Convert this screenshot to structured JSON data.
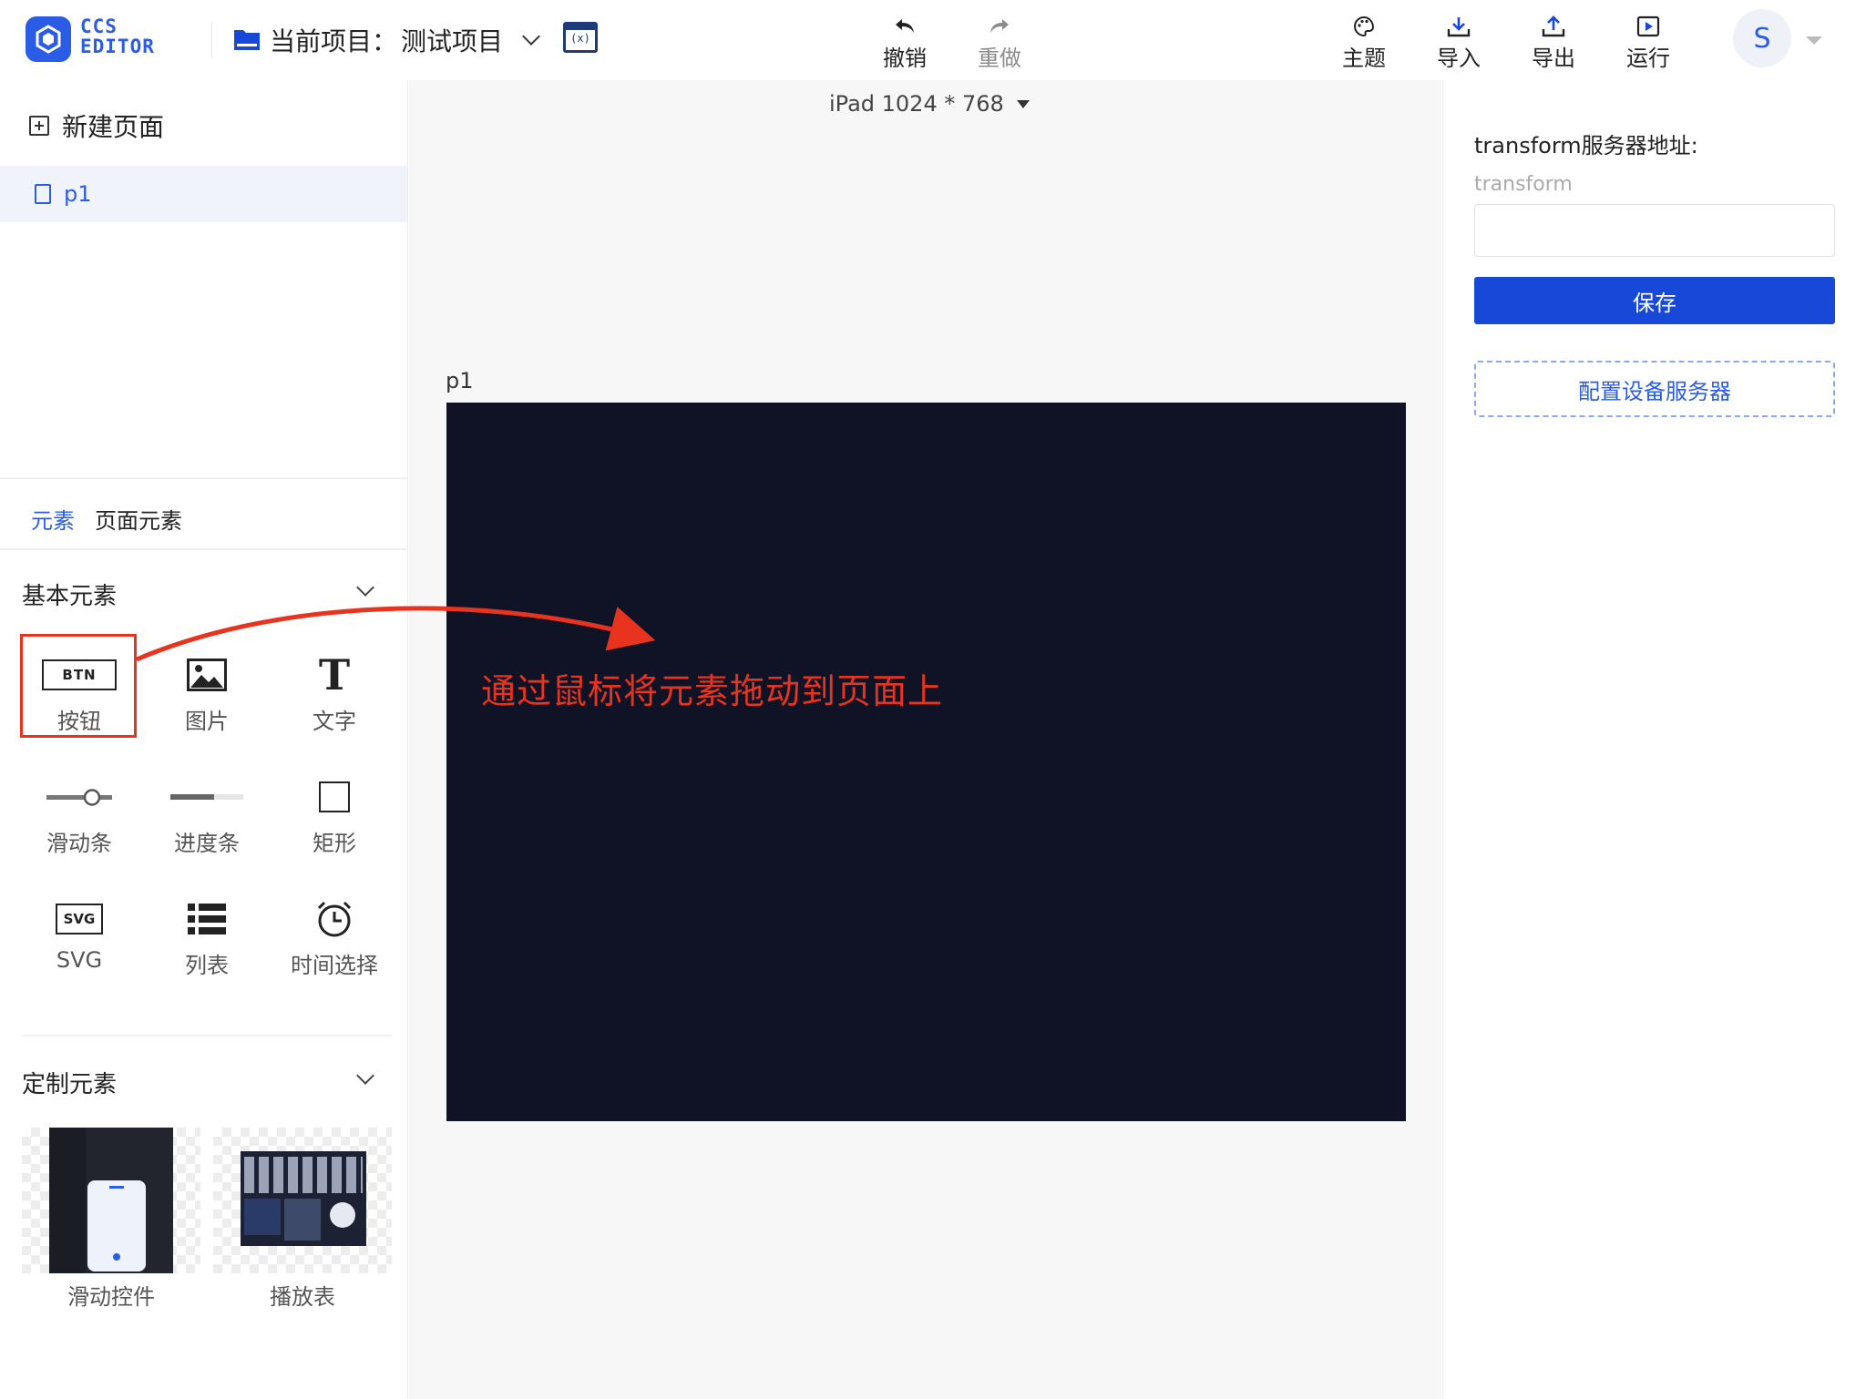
{
  "app": {
    "logo_line1": "CCS",
    "logo_line2": "EDITOR",
    "project_prefix": "当前项目：",
    "project_name": "测试项目",
    "var_icon_text": "(x)"
  },
  "toolbar": {
    "undo": "撤销",
    "redo": "重做",
    "theme": "主题",
    "import": "导入",
    "export": "导出",
    "run": "运行"
  },
  "user": {
    "avatar_letter": "S"
  },
  "pages": {
    "new_page_label": "新建页面",
    "items": [
      {
        "name": "p1"
      }
    ]
  },
  "element_tabs": [
    "元素",
    "页面元素"
  ],
  "basic_elements": {
    "title": "基本元素",
    "items": [
      {
        "label": "按钮",
        "icon": "button-icon",
        "icon_text": "BTN"
      },
      {
        "label": "图片",
        "icon": "image-icon"
      },
      {
        "label": "文字",
        "icon": "text-icon",
        "icon_text": "T"
      },
      {
        "label": "滑动条",
        "icon": "slider-icon"
      },
      {
        "label": "进度条",
        "icon": "progress-icon"
      },
      {
        "label": "矩形",
        "icon": "rectangle-icon"
      },
      {
        "label": "SVG",
        "icon": "svg-icon",
        "icon_text": "SVG"
      },
      {
        "label": "列表",
        "icon": "list-icon"
      },
      {
        "label": "时间选择",
        "icon": "clock-icon"
      }
    ]
  },
  "custom_elements": {
    "title": "定制元素",
    "items": [
      {
        "label": "滑动控件",
        "icon": "slider-widget-thumbnail"
      },
      {
        "label": "播放表",
        "icon": "schedule-thumbnail"
      }
    ]
  },
  "canvas": {
    "device": "iPad 1024 * 768",
    "page_name": "p1",
    "background": "#0f1325",
    "hint": "通过鼠标将元素拖动到页面上"
  },
  "settings": {
    "server_label": "transform服务器地址:",
    "server_sub": "transform",
    "server_value": "",
    "save_label": "保存",
    "config_label": "配置设备服务器"
  },
  "colors": {
    "accent": "#2b5ce6",
    "primary_button": "#1748d8",
    "annotation": "#e8341f"
  }
}
